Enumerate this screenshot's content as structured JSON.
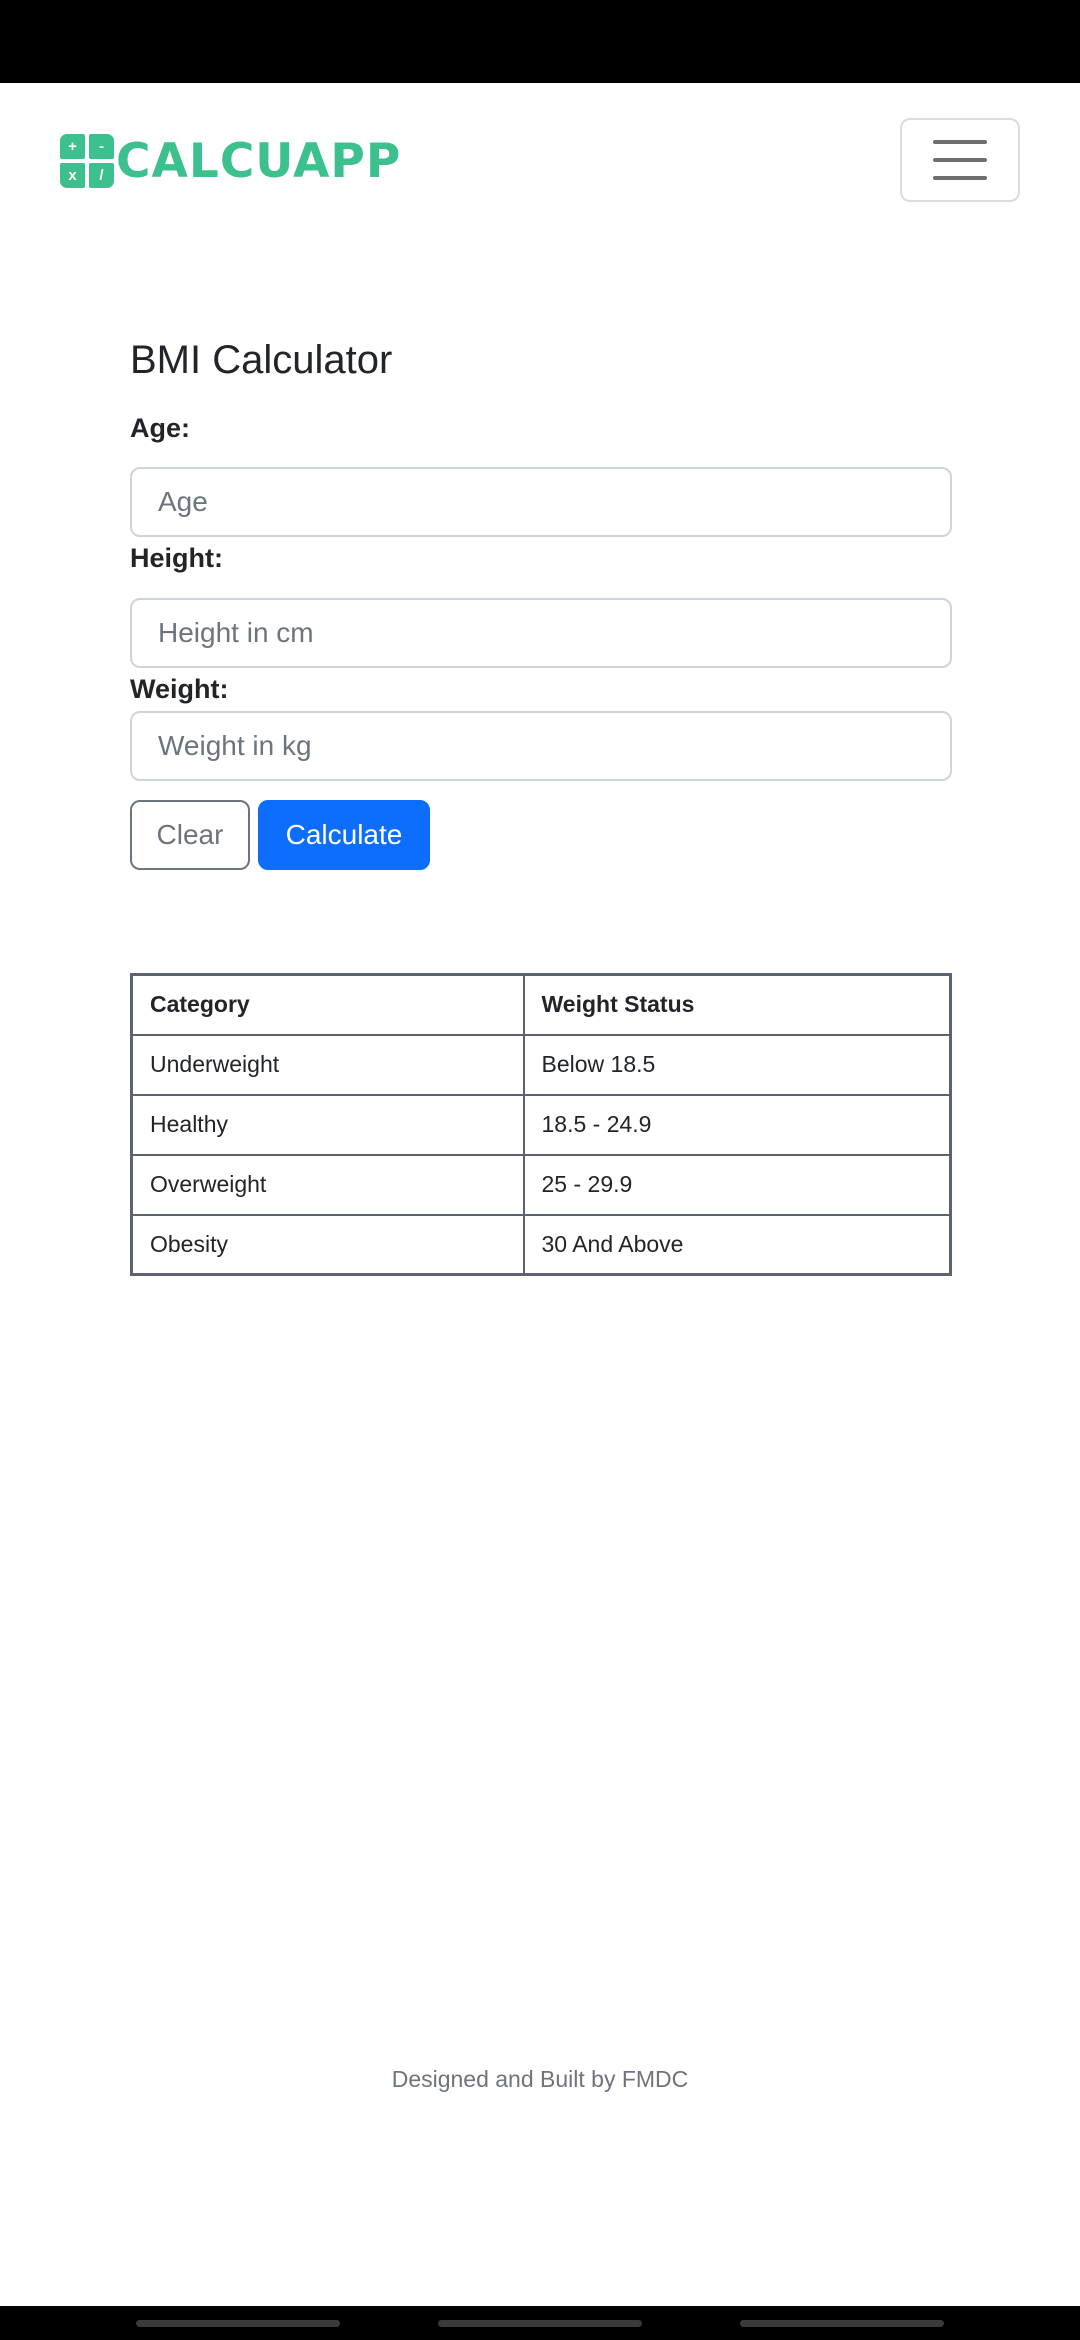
{
  "brand": {
    "name": "CALCUAPP",
    "logo_symbols": [
      "+",
      "-",
      "x",
      "/"
    ],
    "color": "#3cc08e"
  },
  "navbar": {
    "menu_icon": "hamburger-menu-icon"
  },
  "form": {
    "title": "BMI Calculator",
    "age": {
      "label": "Age:",
      "placeholder": "Age",
      "value": ""
    },
    "height": {
      "label": "Height:",
      "placeholder": "Height in cm",
      "value": ""
    },
    "weight": {
      "label": "Weight:",
      "placeholder": "Weight in kg",
      "value": ""
    },
    "clear_label": "Clear",
    "calculate_label": "Calculate",
    "accent_color": "#0d6efd"
  },
  "bmi_table": {
    "headers": [
      "Category",
      "Weight Status"
    ],
    "rows": [
      [
        "Underweight",
        "Below 18.5"
      ],
      [
        "Healthy",
        "18.5 - 24.9"
      ],
      [
        "Overweight",
        "25 - 29.9"
      ],
      [
        "Obesity",
        "30 And Above"
      ]
    ]
  },
  "footer": {
    "text": "Designed and Built by FMDC"
  }
}
